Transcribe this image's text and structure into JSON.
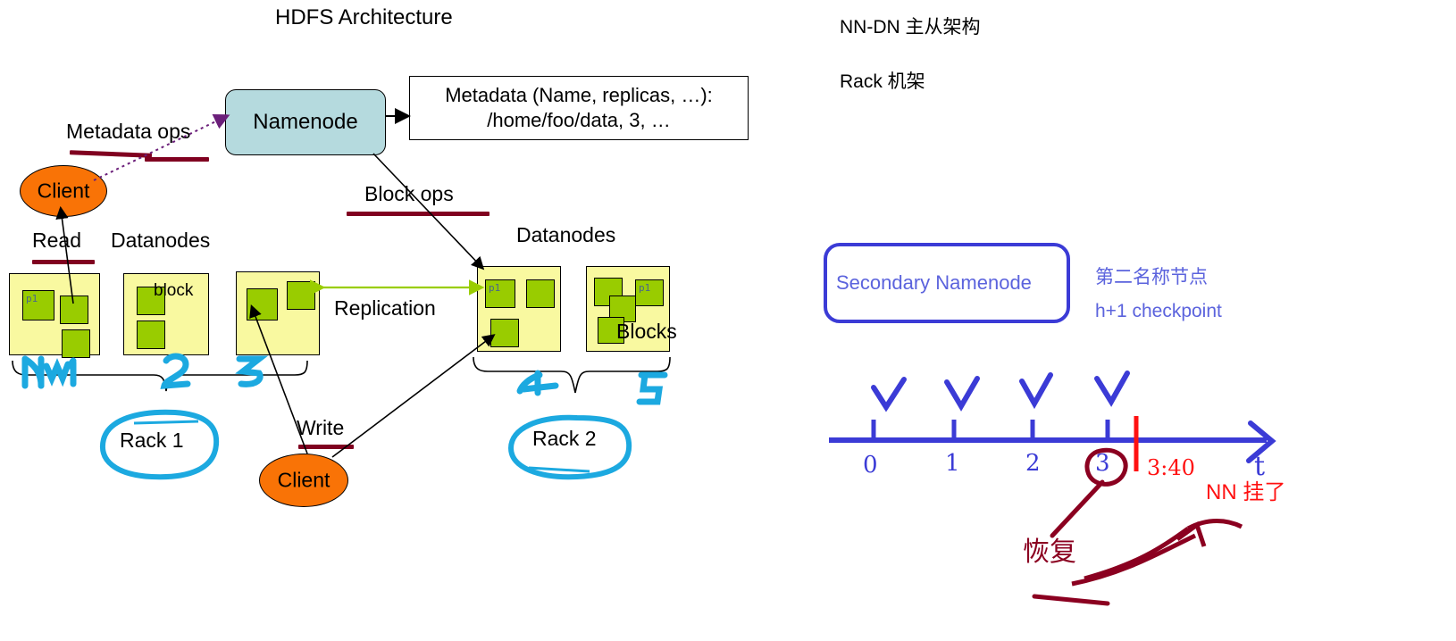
{
  "diagram": {
    "title": "HDFS Architecture",
    "namenode": {
      "label": "Namenode"
    },
    "metadata_box": {
      "line1": "Metadata (Name, replicas, …):",
      "line2": "/home/foo/data, 3, …"
    },
    "edges": {
      "metadata_ops": "Metadata ops",
      "block_ops": "Block ops",
      "replication": "Replication",
      "read": "Read",
      "write": "Write"
    },
    "clients": {
      "client_left": "Client",
      "client_bottom": "Client"
    },
    "datanodes_label_left": "Datanodes",
    "datanodes_label_right": "Datanodes",
    "block_label": "block",
    "blocks_label": "Blocks",
    "block_tag": "p1",
    "racks": {
      "rack1": "Rack 1",
      "rack2": "Rack 2"
    },
    "handwritten_datanode_numbers": [
      "DN1",
      "2",
      "3",
      "4",
      "5"
    ]
  },
  "notes": {
    "nn_dn": "NN-DN 主从架构",
    "rack": "Rack 机架",
    "secondary_namenode": "Secondary Namenode",
    "secondary_cn": "第二名称节点",
    "checkpoint": "h+1 checkpoint"
  },
  "timeline": {
    "ticks": [
      "0",
      "1",
      "2",
      "3"
    ],
    "checks": [
      "✓",
      "✓",
      "✓",
      "✓"
    ],
    "axis_label": "t",
    "circled_tick": "3",
    "red_time": "3:40",
    "red_note": "NN 挂了",
    "darkred_note": "恢复"
  },
  "colors": {
    "namenode_fill": "#b5dade",
    "datanode_fill": "#f9f9a0",
    "block_fill": "#99cc00",
    "client_fill": "#f97306",
    "underline": "#800020",
    "handwrite_cyan": "#1ca9e0",
    "handwrite_blue": "#3b3bd6",
    "handwrite_red": "#ff1111",
    "handwrite_darkred": "#8b0020",
    "replication_arrow": "#9acd00"
  }
}
